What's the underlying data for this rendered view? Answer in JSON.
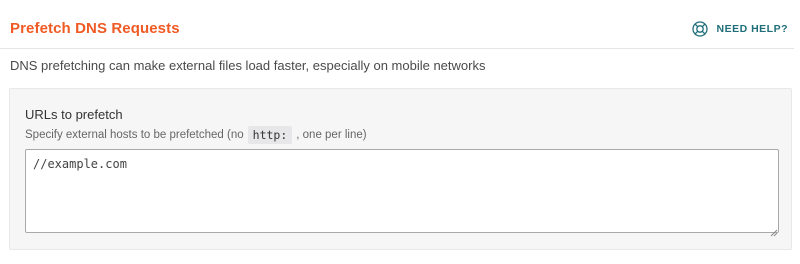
{
  "header": {
    "title": "Prefetch DNS Requests",
    "help_label": "NEED HELP?",
    "help_icon": "lifebuoy-icon"
  },
  "description": "DNS prefetching can make external files load faster, especially on mobile networks",
  "field": {
    "label": "URLs to prefetch",
    "help_before": "Specify external hosts to be prefetched (no",
    "help_code": "http:",
    "help_after": ", one per line)",
    "value": "//example.com"
  },
  "colors": {
    "title": "#f05a24",
    "help": "#1f6f7a",
    "panel_bg": "#f6f6f7"
  }
}
